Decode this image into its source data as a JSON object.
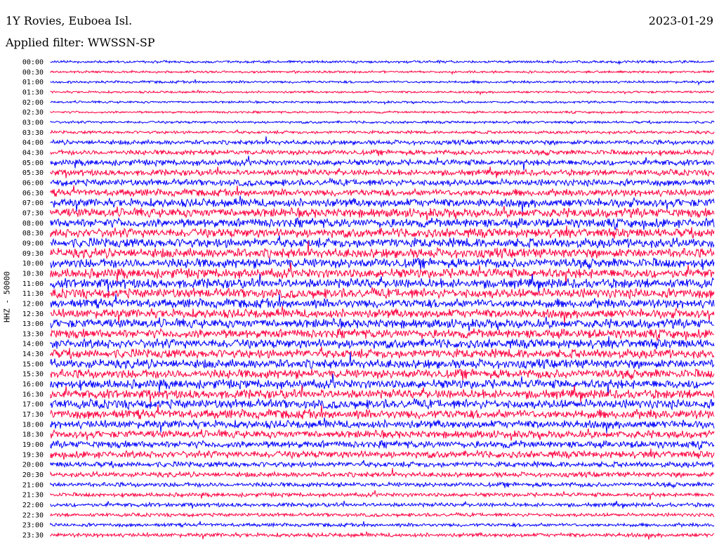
{
  "header": {
    "station": "1Y Rovies, Euboea Isl.",
    "date": "2023-01-29",
    "filter": "Applied filter: WWSSN-SP"
  },
  "chart_data": {
    "type": "line",
    "title": "1Y Rovies, Euboea Isl.",
    "subtitle": "Applied filter: WWSSN-SP",
    "ylabel": "HHZ - 50000",
    "xlabel": "",
    "colors": [
      "#0000ff",
      "#ff0040"
    ],
    "rows": [
      "00:00",
      "00:30",
      "01:00",
      "01:30",
      "02:00",
      "02:30",
      "03:00",
      "03:30",
      "04:00",
      "04:30",
      "05:00",
      "05:30",
      "06:00",
      "06:30",
      "07:00",
      "07:30",
      "08:00",
      "08:30",
      "09:00",
      "09:30",
      "10:00",
      "10:30",
      "11:00",
      "11:30",
      "12:00",
      "12:30",
      "13:00",
      "13:30",
      "14:00",
      "14:30",
      "15:00",
      "15:30",
      "16:00",
      "16:30",
      "17:00",
      "17:30",
      "18:00",
      "18:30",
      "19:00",
      "19:30",
      "20:00",
      "20:30",
      "21:00",
      "21:30",
      "22:00",
      "22:30",
      "23:00",
      "23:30"
    ],
    "relative_amplitude": [
      0.25,
      0.22,
      0.25,
      0.22,
      0.22,
      0.22,
      0.25,
      0.3,
      0.45,
      0.5,
      0.6,
      0.6,
      0.65,
      0.7,
      0.85,
      0.9,
      0.9,
      0.9,
      0.95,
      0.95,
      0.95,
      0.95,
      0.95,
      0.95,
      0.9,
      0.9,
      0.9,
      0.9,
      0.9,
      0.9,
      0.9,
      0.9,
      0.9,
      0.9,
      0.9,
      0.9,
      0.8,
      0.75,
      0.7,
      0.7,
      0.55,
      0.5,
      0.45,
      0.4,
      0.4,
      0.35,
      0.35,
      0.4
    ],
    "minutes_per_row": 30
  }
}
